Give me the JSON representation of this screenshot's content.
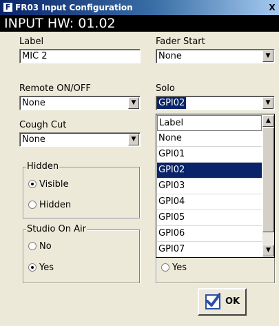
{
  "window": {
    "logo_glyph": "F",
    "title": "FR03 Input Configuration",
    "close_glyph": "X"
  },
  "header": {
    "text": "INPUT HW: 01.02"
  },
  "fields": {
    "label": {
      "label": "Label",
      "value": "MIC 2"
    },
    "fader_start": {
      "label": "Fader Start",
      "value": "None"
    },
    "remote_onoff": {
      "label": "Remote ON/OFF",
      "value": "None"
    },
    "solo": {
      "label": "Solo",
      "value": "GPI02"
    },
    "cough_cut": {
      "label": "Cough Cut",
      "value": "None"
    }
  },
  "hidden_group": {
    "title": "Hidden",
    "options": [
      {
        "label": "Visible",
        "selected": true
      },
      {
        "label": "Hidden",
        "selected": false
      }
    ]
  },
  "studio_on_air_group": {
    "title": "Studio On Air",
    "options": [
      {
        "label": "No",
        "selected": false
      },
      {
        "label": "Yes",
        "selected": true
      }
    ]
  },
  "right_group_partial": {
    "yes_label": "Yes"
  },
  "solo_dropdown": {
    "items": [
      "Label",
      "None",
      "GPI01",
      "GPI02",
      "GPI03",
      "GPI04",
      "GPI05",
      "GPI06",
      "GPI07"
    ],
    "selected_index": 3
  },
  "ok_button": {
    "label": "OK"
  },
  "icons": {
    "dropdown_arrow": "▼",
    "scroll_up": "▲",
    "scroll_down": "▼",
    "check": "✓"
  },
  "colors": {
    "selection": "#0A246A",
    "titlebar_start": "#0A246A",
    "window_bg": "#ECE9D8",
    "header_bg": "#000000"
  }
}
